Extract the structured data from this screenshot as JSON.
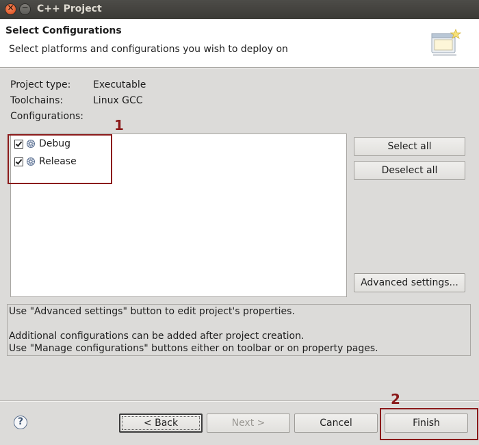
{
  "window": {
    "title": "C++ Project",
    "close_glyph": "×",
    "minimize_glyph": "−"
  },
  "header": {
    "title": "Select Configurations",
    "description": "Select platforms and configurations you wish to deploy on",
    "icon": "wizard-banner-icon"
  },
  "project_info": {
    "project_type_label": "Project type:",
    "project_type_value": "Executable",
    "toolchains_label": "Toolchains:",
    "toolchains_value": "Linux GCC",
    "configurations_label": "Configurations:"
  },
  "configurations": [
    {
      "label": "Debug",
      "checked": true,
      "icon": "configuration-icon"
    },
    {
      "label": "Release",
      "checked": true,
      "icon": "configuration-icon"
    }
  ],
  "side_buttons": {
    "select_all": "Select all",
    "deselect_all": "Deselect all",
    "advanced_settings": "Advanced settings..."
  },
  "message_lines": [
    "Use \"Advanced settings\" button to edit project's properties.",
    "",
    "Additional configurations can be added after project creation.",
    "Use \"Manage configurations\" buttons either on toolbar or on property pages."
  ],
  "footer": {
    "help_glyph": "?",
    "back": "< Back",
    "next": "Next >",
    "cancel": "Cancel",
    "finish": "Finish"
  },
  "annotations": {
    "marker_1": "1",
    "marker_2": "2",
    "color": "#8b1a1a"
  }
}
